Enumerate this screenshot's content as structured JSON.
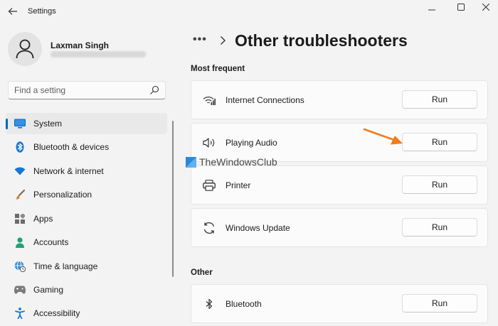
{
  "app": {
    "title": "Settings"
  },
  "window_controls": [
    "minimize-icon",
    "maximize-icon",
    "close-icon"
  ],
  "profile": {
    "name": "Laxman Singh"
  },
  "search": {
    "placeholder": "Find a setting"
  },
  "sidebar": {
    "items": [
      {
        "label": "System",
        "icon": "monitor-icon",
        "selected": true
      },
      {
        "label": "Bluetooth & devices",
        "icon": "bluetooth-icon",
        "selected": false
      },
      {
        "label": "Network & internet",
        "icon": "wifi-icon",
        "selected": false
      },
      {
        "label": "Personalization",
        "icon": "brush-icon",
        "selected": false
      },
      {
        "label": "Apps",
        "icon": "apps-icon",
        "selected": false
      },
      {
        "label": "Accounts",
        "icon": "person-icon",
        "selected": false
      },
      {
        "label": "Time & language",
        "icon": "globe-clock-icon",
        "selected": false
      },
      {
        "label": "Gaming",
        "icon": "gamepad-icon",
        "selected": false
      },
      {
        "label": "Accessibility",
        "icon": "accessibility-icon",
        "selected": false
      }
    ]
  },
  "header": {
    "more": "•••",
    "title": "Other troubleshooters"
  },
  "sections": {
    "most_frequent": {
      "label": "Most frequent",
      "items": [
        {
          "label": "Internet Connections",
          "icon": "wifi-signal-icon",
          "button": "Run"
        },
        {
          "label": "Playing Audio",
          "icon": "speaker-icon",
          "button": "Run"
        },
        {
          "label": "Printer",
          "icon": "printer-icon",
          "button": "Run"
        },
        {
          "label": "Windows Update",
          "icon": "sync-icon",
          "button": "Run"
        }
      ]
    },
    "other": {
      "label": "Other",
      "items": [
        {
          "label": "Bluetooth",
          "icon": "bluetooth-icon",
          "button": "Run"
        }
      ]
    }
  },
  "watermark": {
    "text": "TheWindowsClub"
  },
  "colors": {
    "accent": "#0067c0",
    "arrow": "#f07c1b",
    "background": "#f3f3f3",
    "card": "#fbfbfb"
  }
}
